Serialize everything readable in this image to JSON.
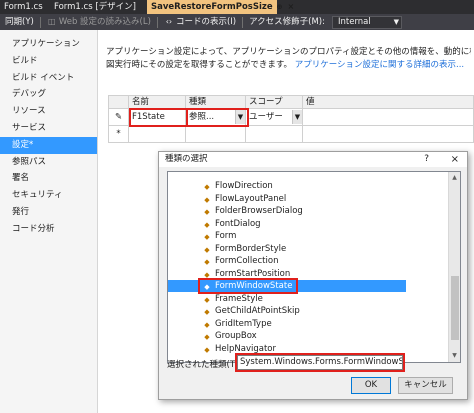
{
  "tabs": [
    {
      "label": "Form1.cs",
      "active": false
    },
    {
      "label": "Form1.cs [デザイン]",
      "active": false
    },
    {
      "label": "SaveRestoreFormPosSize",
      "active": true
    }
  ],
  "active_tab_pin": "⊕",
  "active_tab_close": "×",
  "toolbar": {
    "sync_label": "同期(Y)",
    "load_web_label": "Web 設定の読み込み(L)",
    "view_code_label": "コードの表示(I)",
    "access_modifier_label": "アクセス修飾子(M):",
    "access_modifier_value": "Internal"
  },
  "sidebar": {
    "items": [
      {
        "label": "アプリケーション",
        "selected": false
      },
      {
        "label": "ビルド",
        "selected": false
      },
      {
        "label": "ビルド イベント",
        "selected": false
      },
      {
        "label": "デバッグ",
        "selected": false
      },
      {
        "label": "リソース",
        "selected": false
      },
      {
        "label": "サービス",
        "selected": false
      },
      {
        "label": "設定*",
        "selected": true
      },
      {
        "label": "参照パス",
        "selected": false
      },
      {
        "label": "署名",
        "selected": false
      },
      {
        "label": "セキュリティ",
        "selected": false
      },
      {
        "label": "発行",
        "selected": false
      },
      {
        "label": "コード分析",
        "selected": false
      }
    ]
  },
  "description": {
    "text": "アプリケーション設定によって、アプリケーションのプロパティ設定とその他の情報を、動的に格納、取得するこ",
    "text2": "図実行時にその設定を取得することができます。",
    "link": "アプリケーション設定に関する詳細の表示..."
  },
  "grid": {
    "headers": [
      "",
      "名前",
      "種類",
      "スコープ",
      "値"
    ],
    "rows": [
      {
        "marker": "✎",
        "name": "F1State",
        "type": "参照...",
        "scope": "ユーザー",
        "value": ""
      },
      {
        "marker": "*",
        "name": "",
        "type": "",
        "scope": "",
        "value": ""
      }
    ]
  },
  "dialog": {
    "title": "種類の選択",
    "help": "?",
    "close": "×",
    "tree_items": [
      {
        "label": "FlowDirection",
        "selected": false
      },
      {
        "label": "FlowLayoutPanel",
        "selected": false
      },
      {
        "label": "FolderBrowserDialog",
        "selected": false
      },
      {
        "label": "FontDialog",
        "selected": false
      },
      {
        "label": "Form",
        "selected": false
      },
      {
        "label": "FormBorderStyle",
        "selected": false
      },
      {
        "label": "FormCollection",
        "selected": false
      },
      {
        "label": "FormStartPosition",
        "selected": false
      },
      {
        "label": "FormWindowState",
        "selected": true
      },
      {
        "label": "FrameStyle",
        "selected": false
      },
      {
        "label": "GetChildAtPointSkip",
        "selected": false
      },
      {
        "label": "GridItemType",
        "selected": false
      },
      {
        "label": "GroupBox",
        "selected": false
      },
      {
        "label": "HelpNavigator",
        "selected": false
      }
    ],
    "selected_type_label": "選択された種類(T):",
    "selected_type_value": "System.Windows.Forms.FormWindowState",
    "ok_label": "OK",
    "cancel_label": "キャンセル"
  },
  "colors": {
    "accent": "#3399ff",
    "highlight_box": "#e0201c",
    "active_tab": "#f2c37f"
  }
}
